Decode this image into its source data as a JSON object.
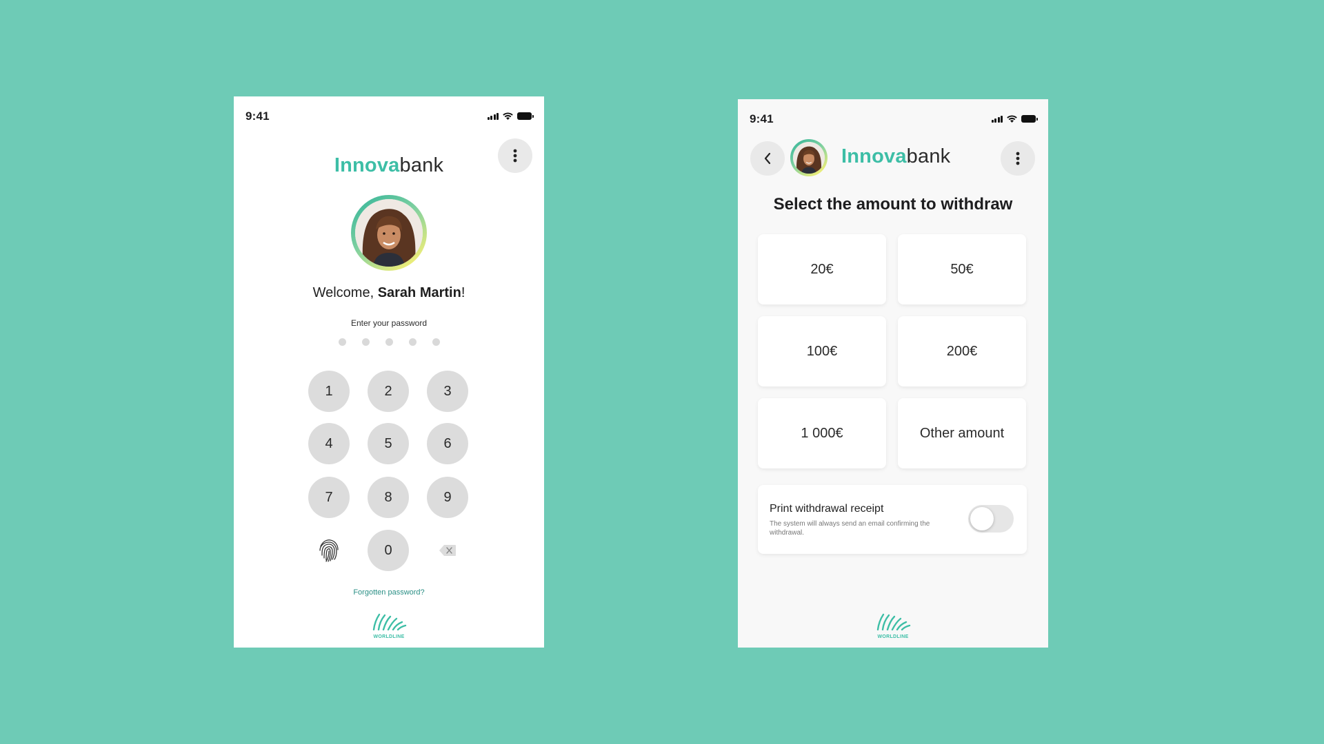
{
  "colors": {
    "background": "#6ecbb6",
    "brand_accent": "#3dbea6",
    "key_background": "#dcdcdc",
    "link": "#2a8f85"
  },
  "login_screen": {
    "status": {
      "time": "9:41",
      "icons": [
        "signal-icon",
        "wifi-icon",
        "battery-icon"
      ]
    },
    "menu_icon": "more-vertical-icon",
    "brand": {
      "accent": "Innova",
      "rest": "bank"
    },
    "welcome": {
      "prefix": "Welcome, ",
      "name": "Sarah Martin",
      "suffix": "!"
    },
    "password_label": "Enter your password",
    "password_dots": 5,
    "keypad": {
      "keys": [
        "1",
        "2",
        "3",
        "4",
        "5",
        "6",
        "7",
        "8",
        "9",
        "0"
      ],
      "extra_left_icon": "fingerprint-icon",
      "extra_right_icon": "backspace-icon"
    },
    "forgot_link": "Forgotten password?",
    "footer_logo": "WORLDLINE"
  },
  "withdraw_screen": {
    "status": {
      "time": "9:41",
      "icons": [
        "signal-icon",
        "wifi-icon",
        "battery-icon"
      ]
    },
    "back_icon": "chevron-left-icon",
    "menu_icon": "more-vertical-icon",
    "brand": {
      "accent": "Innova",
      "rest": "bank"
    },
    "title": "Select the amount to withdraw",
    "amounts": [
      "20€",
      "50€",
      "100€",
      "200€",
      "1 000€",
      "Other amount"
    ],
    "receipt": {
      "title": "Print withdrawal receipt",
      "note": "The system will always send an email confirming the withdrawal.",
      "toggle_on": false
    },
    "footer_logo": "WORLDLINE"
  }
}
